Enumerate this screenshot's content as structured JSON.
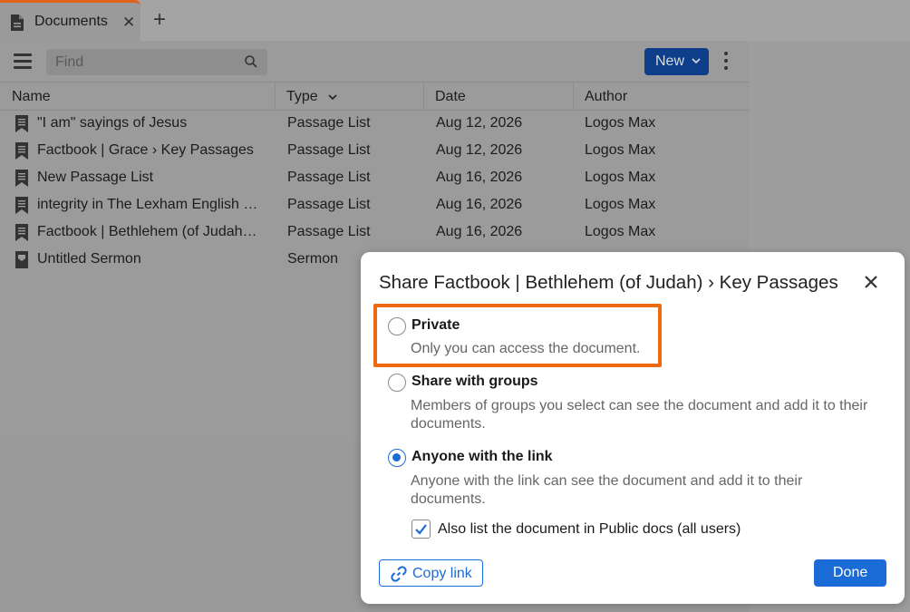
{
  "tabstrip": {
    "tab_title": "Documents",
    "close_glyph": "✕",
    "add_glyph": "+",
    "accent": "#e0621a"
  },
  "toolbar": {
    "find_placeholder": "Find",
    "new_label": "New"
  },
  "columns": [
    "Name",
    "Type",
    "Date",
    "Author"
  ],
  "rows": [
    {
      "name": "\"I am\" sayings of Jesus",
      "type": "Passage List",
      "date": "Aug 12, 2026",
      "author": "Logos Max",
      "icon": "bookmark-list-icon"
    },
    {
      "name": "Factbook | Grace › Key Passages",
      "type": "Passage List",
      "date": "Aug 12, 2026",
      "author": "Logos Max",
      "icon": "bookmark-list-icon"
    },
    {
      "name": "New Passage List",
      "type": "Passage List",
      "date": "Aug 16, 2026",
      "author": "Logos Max",
      "icon": "bookmark-list-icon"
    },
    {
      "name": "integrity in The Lexham English …",
      "type": "Passage List",
      "date": "Aug 16, 2026",
      "author": "Logos Max",
      "icon": "bookmark-list-icon"
    },
    {
      "name": "Factbook | Bethlehem (of Judah…",
      "type": "Passage List",
      "date": "Aug 16, 2026",
      "author": "Logos Max",
      "icon": "bookmark-list-icon"
    },
    {
      "name": "Untitled Sermon",
      "type": "Sermon",
      "date": "",
      "author": "",
      "icon": "sermon-icon"
    }
  ],
  "modal": {
    "title": "Share Factbook | Bethlehem (of Judah) › Key Passages",
    "options": [
      {
        "label": "Private",
        "desc": "Only you can access the document.",
        "selected": false
      },
      {
        "label": "Share with groups",
        "desc": "Members of groups you select can see the document and add it to their documents.",
        "selected": false
      },
      {
        "label": "Anyone with the link",
        "desc": "Anyone with the link can see the document and add it to their documents.",
        "selected": true
      }
    ],
    "public_checkbox_label": "Also list the document in Public docs (all users)",
    "public_checked": true,
    "copy_link_label": "Copy link",
    "done_label": "Done",
    "accent": "#1a6bd6",
    "highlight_color": "#ed6a10"
  }
}
